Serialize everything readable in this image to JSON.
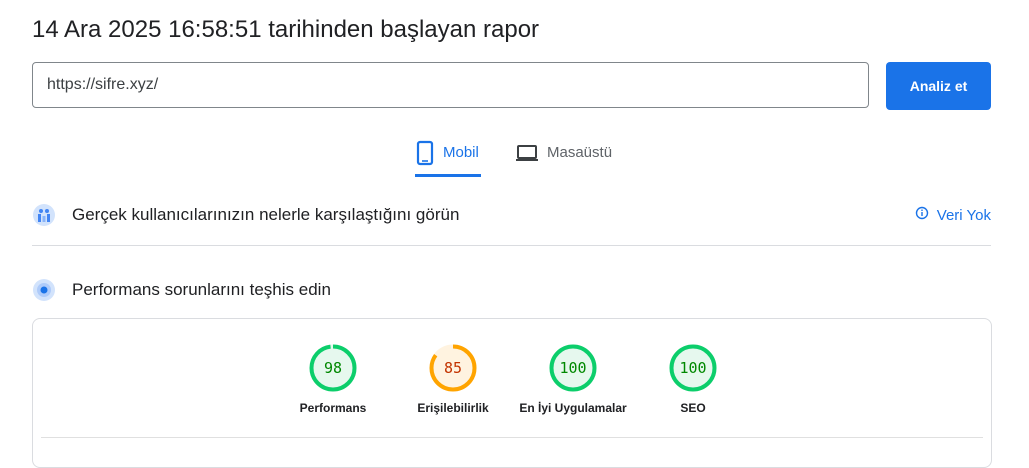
{
  "header": {
    "title": "14 Ara 2025 16:58:51 tarihinden başlayan rapor",
    "url_value": "https://sifre.xyz/",
    "analyze_label": "Analiz et"
  },
  "tabs": [
    {
      "label": "Mobil",
      "active": true,
      "icon": "phone-icon"
    },
    {
      "label": "Masaüstü",
      "active": false,
      "icon": "laptop-icon"
    }
  ],
  "field_data": {
    "heading": "Gerçek kullanıcılarınızın nelerle karşılaştığını görün",
    "status": "Veri Yok",
    "icon": "users-chart-icon",
    "status_icon": "info-icon"
  },
  "lab_data": {
    "heading": "Performans sorunlarını teşhis edin",
    "icon": "lighthouse-icon"
  },
  "scores": [
    {
      "label": "Performans",
      "value": "98",
      "percent": 98,
      "color": "#0cce6b",
      "fill": "#e6f8ee",
      "text": "#008800"
    },
    {
      "label": "Erişilebilirlik",
      "value": "85",
      "percent": 85,
      "color": "#ffa400",
      "fill": "#fff3e0",
      "text": "#c33300"
    },
    {
      "label": "En İyi Uygulamalar",
      "value": "100",
      "percent": 100,
      "color": "#0cce6b",
      "fill": "#e6f8ee",
      "text": "#008800"
    },
    {
      "label": "SEO",
      "value": "100",
      "percent": 100,
      "color": "#0cce6b",
      "fill": "#e6f8ee",
      "text": "#008800"
    }
  ]
}
